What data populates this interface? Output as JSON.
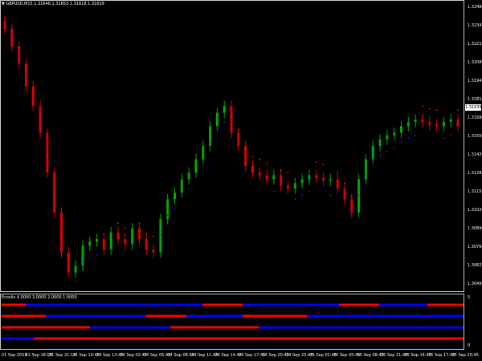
{
  "main_title": "▼ GBPUSD,M15  1.31648 1.31653 1.31618 1.31639",
  "price_box": "1.31639",
  "indicator_title": "Ecoslix 4.0000 3.0000 2.0000 1.0000",
  "subpanel_max_label": "5",
  "subpanel_min_label": "0",
  "colors": {
    "background": "#000000",
    "bull": "#00aa00",
    "bear": "#dd0000",
    "psar_up": "#2222ff",
    "psar_down": "#ff2200",
    "frame": "#c8c8c8",
    "bar_red": "#ff0000",
    "bar_blue": "#0000ff"
  },
  "chart_data": {
    "type": "line",
    "title": "GBPUSD,M15",
    "y_tick_labels": [
      "1.32480",
      "1.32345",
      "1.32210",
      "1.32080",
      "1.31945",
      "1.31815",
      "1.31680",
      "1.31550",
      "1.31420",
      "1.31285",
      "1.31155",
      "1.31020",
      "1.30890",
      "1.30760",
      "1.30625",
      "1.30495"
    ],
    "x_tick_labels": [
      "21 Sep 2018",
      "21 Sep 18:00",
      "21 Sep 21:15",
      "24 Sep 10:45",
      "24 Sep 13:45",
      "24 Sep 02:45",
      "24 Sep 05:45",
      "24 Sep 08:45",
      "24 Sep 11:45",
      "24 Sep 14:45",
      "24 Sep 17:45",
      "24 Sep 20:45",
      "24 Sep 23:45",
      "25 Sep 02:45",
      "25 Sep 05:45",
      "25 Sep 08:45",
      "25 Sep 11:45",
      "25 Sep 14:45",
      "25 Sep 17:45",
      "25 Sep 20:45"
    ],
    "ylim": [
      1.3045,
      1.3255
    ],
    "series": [
      {
        "x_index": [
          0,
          3,
          6,
          9,
          12,
          15,
          18,
          21,
          24,
          27,
          30,
          33,
          36,
          39,
          42,
          45,
          48,
          51,
          54,
          57,
          60,
          63,
          66,
          69,
          72,
          75,
          78,
          81,
          84,
          87,
          90,
          93,
          96,
          99,
          102,
          105,
          108,
          111,
          114,
          117,
          120,
          123,
          126,
          129,
          132,
          135,
          138,
          141,
          144,
          147,
          150,
          153,
          156,
          159,
          162,
          165,
          168,
          171,
          174,
          177,
          180,
          183,
          186,
          189,
          192
        ],
        "close": [
          1.3238,
          1.3225,
          1.3212,
          1.3195,
          1.318,
          1.316,
          1.313,
          1.31,
          1.307,
          1.3055,
          1.306,
          1.3075,
          1.3078,
          1.308,
          1.3072,
          1.3085,
          1.308,
          1.3076,
          1.3088,
          1.308,
          1.3072,
          1.307,
          1.3095,
          1.311,
          1.3115,
          1.3125,
          1.313,
          1.314,
          1.315,
          1.3165,
          1.3175,
          1.318,
          1.316,
          1.315,
          1.3135,
          1.313,
          1.3128,
          1.3125,
          1.3128,
          1.312,
          1.3118,
          1.3122,
          1.3125,
          1.3128,
          1.3126,
          1.3124,
          1.3125,
          1.3118,
          1.311,
          1.31,
          1.3125,
          1.314,
          1.315,
          1.3155,
          1.3158,
          1.316,
          1.3165,
          1.3168,
          1.317,
          1.3168,
          1.3166,
          1.3165,
          1.3168,
          1.317,
          1.3165
        ]
      }
    ],
    "indicator_rows": 4
  }
}
